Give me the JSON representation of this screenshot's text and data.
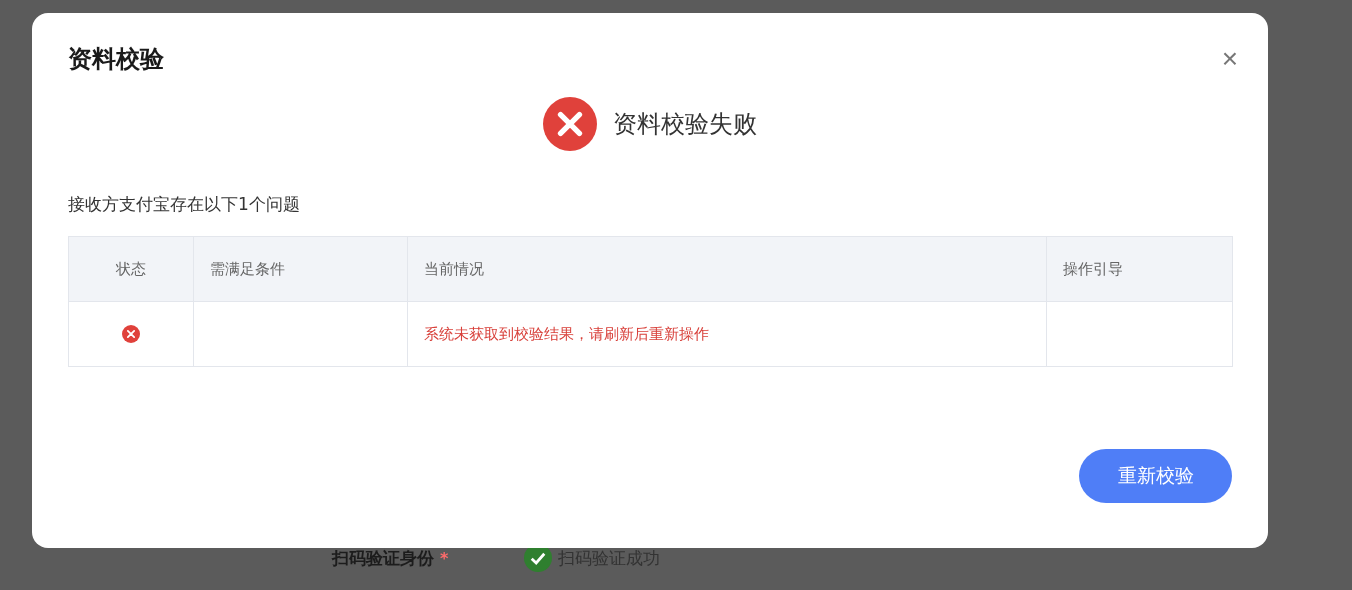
{
  "background": {
    "field_label": "扫码验证身份",
    "required_mark": "*",
    "status_text": "扫码验证成功"
  },
  "dialog": {
    "title": "资料校验",
    "close": "×",
    "result": {
      "kind": "error",
      "text": "资料校验失败"
    },
    "summary": "接收方支付宝存在以下1个问题",
    "table": {
      "columns": [
        "状态",
        "需满足条件",
        "当前情况",
        "操作引导"
      ],
      "rows": [
        {
          "kind": "error",
          "current": "系统未获取到校验结果，请刷新后重新操作"
        }
      ]
    },
    "buttons": [
      "重新校验"
    ]
  }
}
